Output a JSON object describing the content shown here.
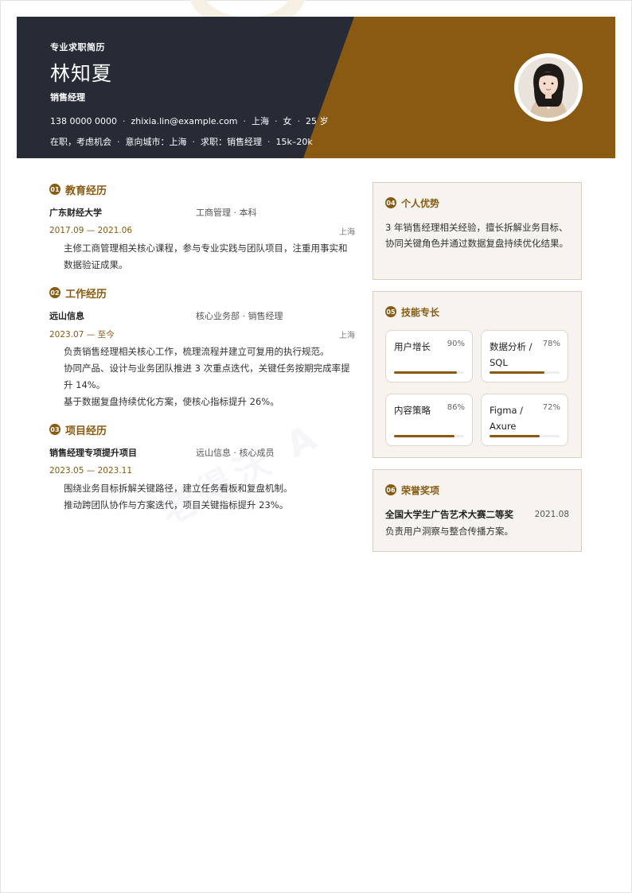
{
  "header": {
    "kicker": "专业求职简历",
    "name": "林知夏",
    "role": "销售经理",
    "phone": "138 0000 0000",
    "email": "zhixia.lin@example.com",
    "city": "上海",
    "gender": "女",
    "age": "25 岁",
    "status": "在职，考虑机会",
    "target_city": "意向城市：上海",
    "target_role": "求职：销售经理",
    "salary": "15k–20k",
    "separator": "·"
  },
  "watermark": "老得沃 A",
  "education": {
    "badge": "01",
    "title": "教育经历",
    "entries": [
      {
        "org": "广东财经大学",
        "sub": "工商管理 · 本科",
        "date": "2017.09 — 2021.06",
        "location": "上海",
        "bullets": [
          "主修工商管理相关核心课程，参与专业实践与团队项目，注重用事实和数据验证成果。"
        ]
      }
    ]
  },
  "work": {
    "badge": "02",
    "title": "工作经历",
    "entries": [
      {
        "org": "远山信息",
        "sub": "核心业务部 · 销售经理",
        "date": "2023.07 — 至今",
        "location": "上海",
        "bullets": [
          "负责销售经理相关核心工作，梳理流程并建立可复用的执行规范。",
          "协同产品、设计与业务团队推进 3 次重点迭代，关键任务按期完成率提升 14%。",
          "基于数据复盘持续优化方案，使核心指标提升 26%。"
        ]
      }
    ]
  },
  "projects": {
    "badge": "03",
    "title": "项目经历",
    "entries": [
      {
        "org": "销售经理专项提升项目",
        "sub": "远山信息 · 核心成员",
        "date": "2023.05 — 2023.11",
        "location": "",
        "bullets": [
          "围绕业务目标拆解关键路径，建立任务看板和复盘机制。",
          "推动跨团队协作与方案迭代，项目关键指标提升 23%。"
        ]
      }
    ]
  },
  "advantages": {
    "badge": "04",
    "title": "个人优势",
    "text": "3 年销售经理相关经验，擅长拆解业务目标、协同关键角色并通过数据复盘持续优化结果。"
  },
  "skills": {
    "badge": "05",
    "title": "技能专长",
    "items": [
      {
        "name": "用户增长",
        "percent": "90%",
        "level": 0.9
      },
      {
        "name": "数据分析 / SQL",
        "percent": "78%",
        "level": 0.78
      },
      {
        "name": "内容策略",
        "percent": "86%",
        "level": 0.86
      },
      {
        "name": "Figma / Axure",
        "percent": "72%",
        "level": 0.72
      }
    ]
  },
  "awards": {
    "badge": "06",
    "title": "荣誉奖项",
    "items": [
      {
        "name": "全国大学生广告艺术大赛二等奖",
        "date": "2021.08",
        "desc": "负责用户洞察与整合传播方案。"
      }
    ]
  },
  "colors": {
    "accent": "#8a5a12",
    "header_dark": "#262b36",
    "card_bg": "#f7f4ef"
  }
}
